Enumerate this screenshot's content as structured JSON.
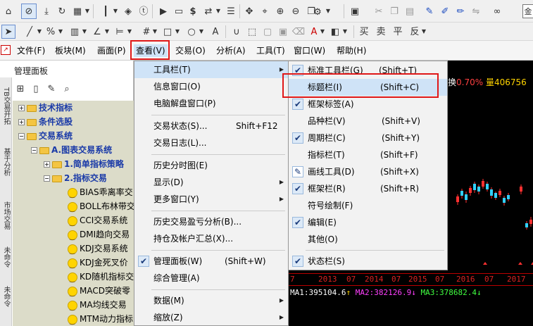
{
  "menubar": {
    "items": [
      "文件(F)",
      "板块(M)",
      "画面(P)",
      "查看(V)",
      "交易(O)",
      "分析(A)",
      "工具(T)",
      "窗口(W)",
      "帮助(H)"
    ]
  },
  "toolbar": {
    "gold_char": "金",
    "trade_labels": [
      "买",
      "卖",
      "平",
      "反"
    ]
  },
  "panel": {
    "title": "管理面板",
    "vertical_tabs": [
      "TB交易开拓",
      "基于分析",
      "市场交易",
      "未命令",
      "未命令"
    ]
  },
  "tree": [
    {
      "label": "技术指标",
      "kind": "folder",
      "level": 0
    },
    {
      "label": "条件选股",
      "kind": "folder",
      "level": 0
    },
    {
      "label": "交易系统",
      "kind": "folder",
      "level": 0
    },
    {
      "label": "A.图表交易系统",
      "kind": "folder",
      "level": 1
    },
    {
      "label": "1.简单指标策略",
      "kind": "folder",
      "level": 2
    },
    {
      "label": "2.指标交易",
      "kind": "folder",
      "level": 2
    },
    {
      "label": "BIAS乖离率交",
      "kind": "strategy",
      "level": 3
    },
    {
      "label": "BOLL布林带交",
      "kind": "strategy",
      "level": 3
    },
    {
      "label": "CCI交易系统",
      "kind": "strategy",
      "level": 3
    },
    {
      "label": "DMI趋向交易",
      "kind": "strategy",
      "level": 3
    },
    {
      "label": "KDJ交易系统",
      "kind": "strategy",
      "level": 3
    },
    {
      "label": "KDJ金死叉价",
      "kind": "strategy",
      "level": 3
    },
    {
      "label": "KD随机指标交",
      "kind": "strategy",
      "level": 3
    },
    {
      "label": "MACD突破零",
      "kind": "strategy",
      "level": 3
    },
    {
      "label": "MA均线交易",
      "kind": "strategy",
      "level": 3
    },
    {
      "label": "MTM动力指标",
      "kind": "strategy",
      "level": 3
    }
  ],
  "view_menu": {
    "items": [
      {
        "label": "工具栏(T)",
        "shortcut": "",
        "submenu": true,
        "checked": false,
        "highlighted": true
      },
      {
        "label": "信息窗口(O)",
        "shortcut": "",
        "submenu": false,
        "checked": false
      },
      {
        "label": "电脑解盘窗口(P)",
        "shortcut": "",
        "submenu": false,
        "checked": false
      },
      {
        "label": "交易状态(S)...",
        "shortcut": "Shift+F12",
        "submenu": false,
        "checked": false,
        "sep_before": true
      },
      {
        "label": "交易日志(L)...",
        "shortcut": "",
        "submenu": false,
        "checked": false
      },
      {
        "label": "历史分时图(E)",
        "shortcut": "",
        "submenu": false,
        "checked": false,
        "sep_before": true
      },
      {
        "label": "显示(D)",
        "shortcut": "",
        "submenu": true,
        "checked": false
      },
      {
        "label": "更多窗口(Y)",
        "shortcut": "",
        "submenu": true,
        "checked": false
      },
      {
        "label": "历史交易盈亏分析(B)...",
        "shortcut": "",
        "submenu": false,
        "checked": false,
        "sep_before": true
      },
      {
        "label": "持仓及帐户汇总(X)...",
        "shortcut": "",
        "submenu": false,
        "checked": false
      },
      {
        "label": "管理面板(W)",
        "shortcut": "(Shift+W)",
        "submenu": false,
        "checked": true,
        "sep_before": true
      },
      {
        "label": "综合管理(A)",
        "shortcut": "",
        "submenu": false,
        "checked": false
      },
      {
        "label": "数据(M)",
        "shortcut": "",
        "submenu": true,
        "checked": false,
        "sep_before": true
      },
      {
        "label": "缩放(Z)",
        "shortcut": "",
        "submenu": true,
        "checked": false
      }
    ]
  },
  "toolbar_submenu": {
    "items": [
      {
        "label": "标准工具栏(G)",
        "shortcut": "(Shift+T)",
        "checked": true
      },
      {
        "label": "标题栏(I)",
        "shortcut": "(Shift+C)",
        "checked": false,
        "highlighted": true
      },
      {
        "label": "框架标签(A)",
        "shortcut": "",
        "checked": true
      },
      {
        "label": "品种栏(V)",
        "shortcut": "(Shift+V)",
        "checked": false
      },
      {
        "label": "周期栏(C)",
        "shortcut": "(Shift+Y)",
        "checked": true
      },
      {
        "label": "指标栏(T)",
        "shortcut": "(Shift+F)",
        "checked": false
      },
      {
        "label": "画线工具(D)",
        "shortcut": "(Shift+X)",
        "checked": false,
        "pen": true
      },
      {
        "label": "框架栏(R)",
        "shortcut": "(Shift+R)",
        "checked": true
      },
      {
        "label": "符号绘制(F)",
        "shortcut": "",
        "checked": false
      },
      {
        "label": "编辑(E)",
        "shortcut": "",
        "checked": true
      },
      {
        "label": "其他(O)",
        "shortcut": "",
        "checked": false
      },
      {
        "label": "状态栏(S)",
        "shortcut": "",
        "checked": true,
        "sep_before": true
      }
    ]
  },
  "quote": {
    "change_label": "换",
    "change_value": "0.70%",
    "volume_label": "量",
    "volume_value": "406756"
  },
  "years": [
    "7",
    "2013",
    "07",
    "2014",
    "07",
    "2015",
    "07",
    "2016",
    "07",
    "2017"
  ],
  "ma": [
    {
      "name": "MA1",
      "value": "395104.6",
      "dir": "↑",
      "color": "#ffffff"
    },
    {
      "name": "MA2",
      "value": "382126.9",
      "dir": "↓",
      "color": "#ff40ff"
    },
    {
      "name": "MA3",
      "value": "378682.4",
      "dir": "↓",
      "color": "#40ff40"
    }
  ],
  "colors": {
    "highlight_box": "#e01818",
    "tree_blue": "#1a3aa8",
    "chart_bg": "#000000",
    "menu_hl": "#cfe3f7"
  }
}
